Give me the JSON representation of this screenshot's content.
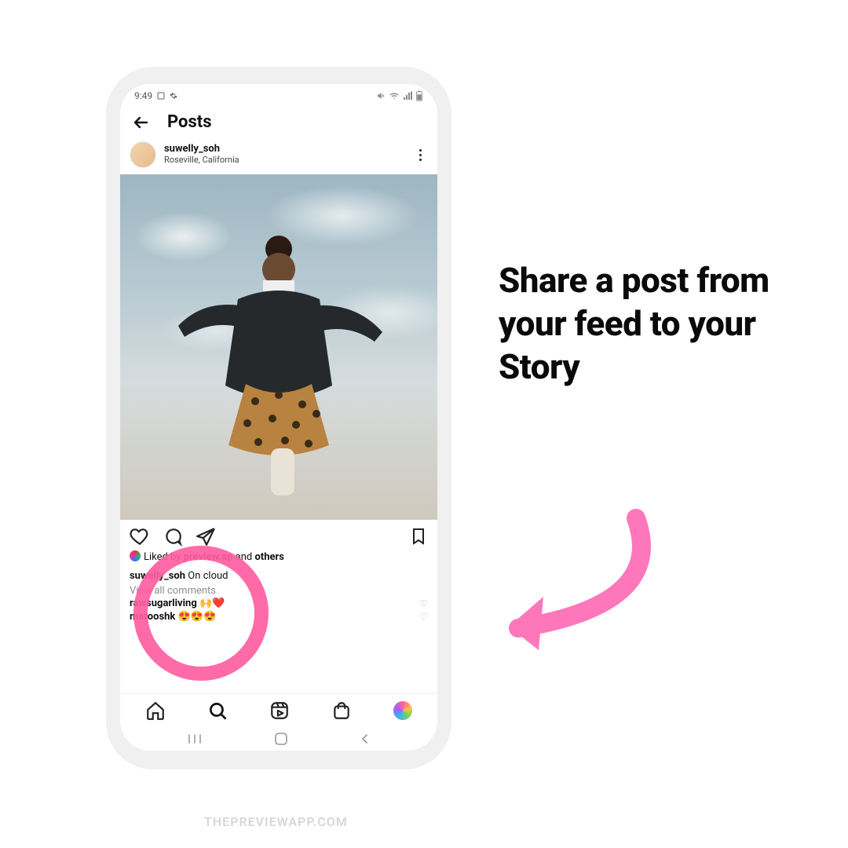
{
  "statusbar": {
    "time": "9:49"
  },
  "header": {
    "title": "Posts"
  },
  "post": {
    "username": "suwelly_soh",
    "location": "Roseville, California",
    "liked_prefix": "Liked by ",
    "liked_by": "preview.ap",
    "liked_mid": " and ",
    "liked_others": "others",
    "caption_user": "suwelly_soh",
    "caption_text": " On cloud",
    "viewall": "View all comments",
    "comment1_user": "rawsugarliving",
    "comment1_text": " 🙌❤️",
    "comment2_user": "marooshk",
    "comment2_text": " 😍😍😍"
  },
  "instruction": "Share a post from your feed to your Story",
  "watermark": "THEPREVIEWAPP.COM"
}
